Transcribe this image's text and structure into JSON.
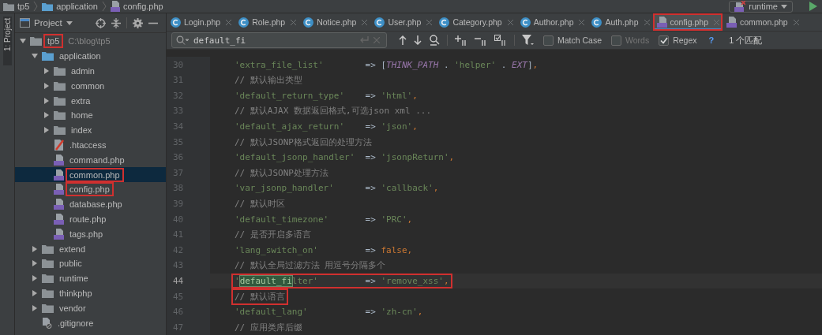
{
  "breadcrumb": [
    {
      "label": "tp5",
      "kind": "folder"
    },
    {
      "label": "application",
      "kind": "source_folder"
    },
    {
      "label": "config.php",
      "kind": "php"
    }
  ],
  "run_config": {
    "label": "runtime"
  },
  "tool_strip": {
    "label": "1: Project"
  },
  "project_panel": {
    "title": "Project",
    "tree": [
      {
        "label": "tp5",
        "path": "C:\\blog\\tp5",
        "kind": "folder",
        "expanded": true,
        "selected": false,
        "annotated": true,
        "children": [
          {
            "label": "application",
            "kind": "source_folder",
            "expanded": true,
            "selected": false,
            "annotated": false,
            "children": [
              {
                "label": "admin",
                "kind": "folder",
                "expanded": false,
                "selected": false,
                "annotated": false
              },
              {
                "label": "common",
                "kind": "folder",
                "expanded": false,
                "selected": false,
                "annotated": false
              },
              {
                "label": "extra",
                "kind": "folder",
                "expanded": false,
                "selected": false,
                "annotated": false
              },
              {
                "label": "home",
                "kind": "folder",
                "expanded": false,
                "selected": false,
                "annotated": false
              },
              {
                "label": "index",
                "kind": "folder",
                "expanded": false,
                "selected": false,
                "annotated": false
              },
              {
                "label": ".htaccess",
                "kind": "htaccess",
                "selected": false,
                "annotated": false
              },
              {
                "label": "command.php",
                "kind": "php",
                "selected": false,
                "annotated": false
              },
              {
                "label": "common.php",
                "kind": "php",
                "selected": true,
                "annotated": true
              },
              {
                "label": "config.php",
                "kind": "php",
                "selected": false,
                "annotated": true
              },
              {
                "label": "database.php",
                "kind": "php",
                "selected": false,
                "annotated": false
              },
              {
                "label": "route.php",
                "kind": "php",
                "selected": false,
                "annotated": false
              },
              {
                "label": "tags.php",
                "kind": "php",
                "selected": false,
                "annotated": false
              }
            ]
          },
          {
            "label": "extend",
            "kind": "folder",
            "expanded": false,
            "selected": false,
            "annotated": false
          },
          {
            "label": "public",
            "kind": "folder",
            "expanded": false,
            "selected": false,
            "annotated": false
          },
          {
            "label": "runtime",
            "kind": "folder",
            "expanded": false,
            "selected": false,
            "annotated": false
          },
          {
            "label": "thinkphp",
            "kind": "folder",
            "expanded": false,
            "selected": false,
            "annotated": false
          },
          {
            "label": "vendor",
            "kind": "folder",
            "expanded": false,
            "selected": false,
            "annotated": false
          },
          {
            "label": ".gitignore",
            "kind": "gitignore",
            "selected": false,
            "annotated": false
          }
        ]
      }
    ]
  },
  "tabs": [
    {
      "label": "Login.php",
      "kind": "class",
      "selected": false,
      "annotated": false
    },
    {
      "label": "Role.php",
      "kind": "class",
      "selected": false,
      "annotated": false
    },
    {
      "label": "Notice.php",
      "kind": "class",
      "selected": false,
      "annotated": false
    },
    {
      "label": "User.php",
      "kind": "class",
      "selected": false,
      "annotated": false
    },
    {
      "label": "Category.php",
      "kind": "class",
      "selected": false,
      "annotated": false
    },
    {
      "label": "Author.php",
      "kind": "class",
      "selected": false,
      "annotated": false
    },
    {
      "label": "Auth.php",
      "kind": "class",
      "selected": false,
      "annotated": false
    },
    {
      "label": "config.php",
      "kind": "php",
      "selected": true,
      "annotated": true
    },
    {
      "label": "common.php",
      "kind": "php",
      "selected": false,
      "annotated": false
    }
  ],
  "find_bar": {
    "value": "default_fi",
    "options": [
      {
        "label": "Match Case",
        "checked": false,
        "disabled": false
      },
      {
        "label": "Words",
        "checked": false,
        "disabled": true
      },
      {
        "label": "Regex",
        "checked": true,
        "disabled": false
      }
    ],
    "help": "?",
    "result": "1 个匹配"
  },
  "code_lines": [
    {
      "number": "30",
      "current": false,
      "annotated": false,
      "segments": [
        {
          "kind": "str",
          "text": "'extra_file_list'"
        },
        {
          "kind": "op",
          "text": "        => "
        },
        {
          "kind": "op",
          "text": "["
        },
        {
          "kind": "const",
          "text": "THINK_PATH"
        },
        {
          "kind": "op",
          "text": " . "
        },
        {
          "kind": "str",
          "text": "'helper'"
        },
        {
          "kind": "op",
          "text": " . "
        },
        {
          "kind": "const",
          "text": "EXT"
        },
        {
          "kind": "op",
          "text": "]"
        },
        {
          "kind": "kw",
          "text": ","
        }
      ]
    },
    {
      "number": "31",
      "current": false,
      "annotated": false,
      "segments": [
        {
          "kind": "comment",
          "text": "// 默认输出类型"
        }
      ]
    },
    {
      "number": "32",
      "current": false,
      "annotated": false,
      "segments": [
        {
          "kind": "str",
          "text": "'default_return_type'"
        },
        {
          "kind": "op",
          "text": "    => "
        },
        {
          "kind": "str",
          "text": "'html'"
        },
        {
          "kind": "kw",
          "text": ","
        }
      ]
    },
    {
      "number": "33",
      "current": false,
      "annotated": false,
      "segments": [
        {
          "kind": "comment",
          "text": "// 默认AJAX 数据返回格式,可选json xml ..."
        }
      ]
    },
    {
      "number": "34",
      "current": false,
      "annotated": false,
      "segments": [
        {
          "kind": "str",
          "text": "'default_ajax_return'"
        },
        {
          "kind": "op",
          "text": "    => "
        },
        {
          "kind": "str",
          "text": "'json'"
        },
        {
          "kind": "kw",
          "text": ","
        }
      ]
    },
    {
      "number": "35",
      "current": false,
      "annotated": false,
      "segments": [
        {
          "kind": "comment",
          "text": "// 默认JSONP格式返回的处理方法"
        }
      ]
    },
    {
      "number": "36",
      "current": false,
      "annotated": false,
      "segments": [
        {
          "kind": "str",
          "text": "'default_jsonp_handler'"
        },
        {
          "kind": "op",
          "text": "  => "
        },
        {
          "kind": "str",
          "text": "'jsonpReturn'"
        },
        {
          "kind": "kw",
          "text": ","
        }
      ]
    },
    {
      "number": "37",
      "current": false,
      "annotated": false,
      "segments": [
        {
          "kind": "comment",
          "text": "// 默认JSONP处理方法"
        }
      ]
    },
    {
      "number": "38",
      "current": false,
      "annotated": false,
      "segments": [
        {
          "kind": "str",
          "text": "'var_jsonp_handler'"
        },
        {
          "kind": "op",
          "text": "      => "
        },
        {
          "kind": "str",
          "text": "'callback'"
        },
        {
          "kind": "kw",
          "text": ","
        }
      ]
    },
    {
      "number": "39",
      "current": false,
      "annotated": false,
      "segments": [
        {
          "kind": "comment",
          "text": "// 默认时区"
        }
      ]
    },
    {
      "number": "40",
      "current": false,
      "annotated": false,
      "segments": [
        {
          "kind": "str",
          "text": "'default_timezone'"
        },
        {
          "kind": "op",
          "text": "       => "
        },
        {
          "kind": "str",
          "text": "'PRC'"
        },
        {
          "kind": "kw",
          "text": ","
        }
      ]
    },
    {
      "number": "41",
      "current": false,
      "annotated": false,
      "segments": [
        {
          "kind": "comment",
          "text": "// 是否开启多语言"
        }
      ]
    },
    {
      "number": "42",
      "current": false,
      "annotated": false,
      "segments": [
        {
          "kind": "str",
          "text": "'lang_switch_on'"
        },
        {
          "kind": "op",
          "text": "         => "
        },
        {
          "kind": "kw",
          "text": "false,"
        }
      ]
    },
    {
      "number": "43",
      "current": false,
      "annotated": false,
      "segments": [
        {
          "kind": "comment",
          "text": "// 默认全局过滤方法 用逗号分隔多个"
        }
      ]
    },
    {
      "number": "44",
      "current": true,
      "annotated": true,
      "segments": [
        {
          "kind": "str",
          "text": "'"
        },
        {
          "kind": "match",
          "text": "default_fi"
        },
        {
          "kind": "str",
          "text": "lter'"
        },
        {
          "kind": "op",
          "text": "         => "
        },
        {
          "kind": "str",
          "text": "'remove_xss'"
        },
        {
          "kind": "kw",
          "text": ","
        }
      ]
    },
    {
      "number": "45",
      "current": false,
      "annotated": true,
      "segments": [
        {
          "kind": "comment",
          "text": "// 默认语言"
        }
      ]
    },
    {
      "number": "46",
      "current": false,
      "annotated": false,
      "segments": [
        {
          "kind": "str",
          "text": "'default_lang'"
        },
        {
          "kind": "op",
          "text": "           => "
        },
        {
          "kind": "str",
          "text": "'zh-cn'"
        },
        {
          "kind": "kw",
          "text": ","
        }
      ]
    },
    {
      "number": "47",
      "current": false,
      "annotated": false,
      "segments": [
        {
          "kind": "comment",
          "text": "// 应用类库后缀"
        }
      ]
    }
  ]
}
